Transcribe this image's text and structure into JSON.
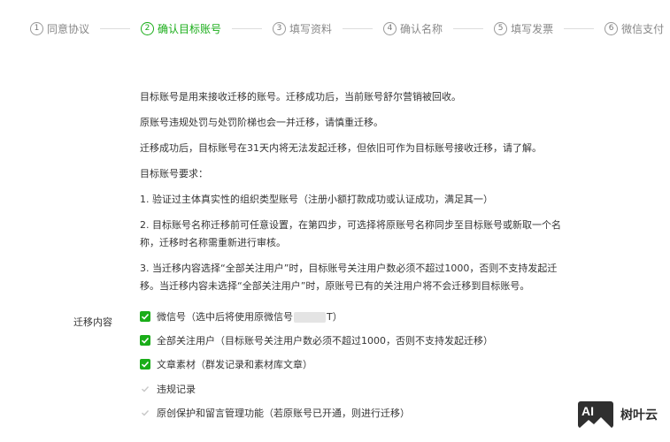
{
  "steps": [
    {
      "num": "1",
      "label": "同意协议",
      "active": false
    },
    {
      "num": "2",
      "label": "确认目标账号",
      "active": true
    },
    {
      "num": "3",
      "label": "填写资料",
      "active": false
    },
    {
      "num": "4",
      "label": "确认名称",
      "active": false
    },
    {
      "num": "5",
      "label": "填写发票",
      "active": false
    },
    {
      "num": "6",
      "label": "微信支付",
      "active": false
    }
  ],
  "content": {
    "p1": "目标账号是用来接收迁移的账号。迁移成功后，当前账号舒尔营销被回收。",
    "p2": "原账号违规处罚与处罚阶梯也会一并迁移，请慎重迁移。",
    "p3": "迁移成功后，目标账号在31天内将无法发起迁移，但依旧可作为目标账号接收迁移，请了解。",
    "req_title": "目标账号要求：",
    "req1": "1. 验证过主体真实性的组织类型账号（注册小额打款成功或认证成功，满足其一）",
    "req2": "2. 目标账号名称迁移前可任意设置，在第四步，可选择将原账号名称同步至目标账号或新取一个名称，迁移时名称需重新进行审核。",
    "req3": "3. 当迁移内容选择“全部关注用户”时，目标账号关注用户数必须不超过1000，否则不支持发起迁移。当迁移内容未选择“全部关注用户”时，原账号已有的关注用户将不会迁移到目标账号。"
  },
  "migrate": {
    "label": "迁移内容",
    "options": [
      {
        "text_before": "微信号（选中后将使用原微信号",
        "text_after": "T）",
        "checked": true,
        "disabled": false
      },
      {
        "text": "全部关注用户（目标账号关注用户数必须不超过1000，否则不支持发起迁移）",
        "checked": true,
        "disabled": false
      },
      {
        "text": "文章素材（群发记录和素材库文章）",
        "checked": true,
        "disabled": false
      },
      {
        "text": "违规记录",
        "checked": true,
        "disabled": true
      },
      {
        "text": "原创保护和留言管理功能（若原账号已开通，则进行迁移）",
        "checked": true,
        "disabled": true
      }
    ]
  },
  "watermark": {
    "logo": "AI",
    "text": "树叶云"
  },
  "colors": {
    "accent": "#1aad19",
    "text": "#353535",
    "muted": "#888888",
    "disabled_check": "#c8c8c8"
  }
}
